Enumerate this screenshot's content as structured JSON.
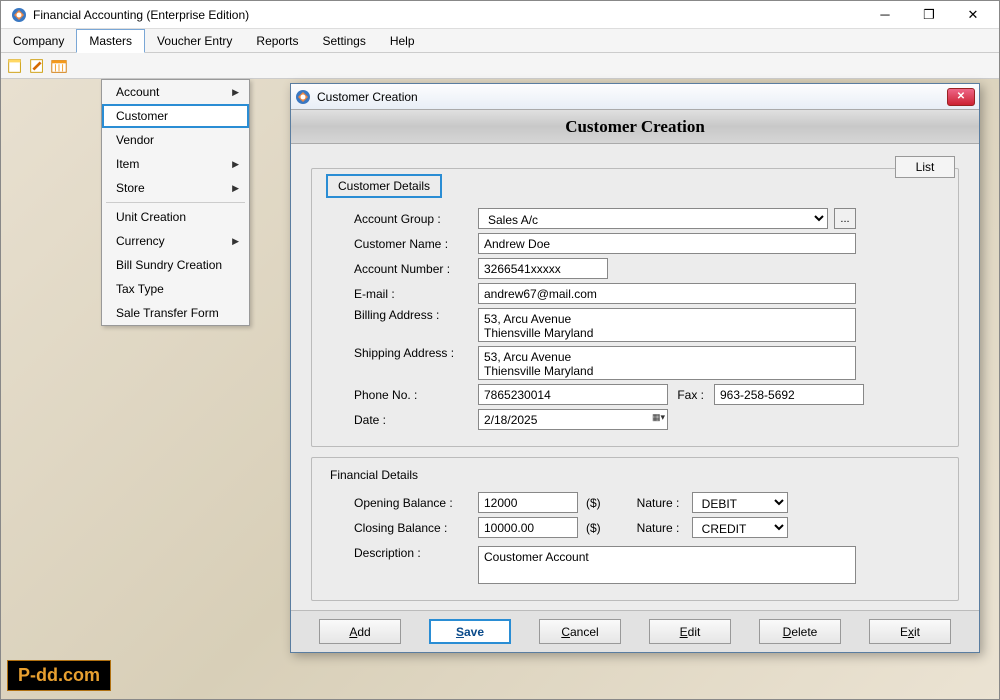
{
  "app": {
    "title": "Financial Accounting (Enterprise Edition)"
  },
  "menu": {
    "items": [
      "Company",
      "Masters",
      "Voucher Entry",
      "Reports",
      "Settings",
      "Help"
    ],
    "active": "Masters"
  },
  "masters_dropdown": {
    "groups": [
      [
        "Account",
        "Customer",
        "Vendor",
        "Item",
        "Store"
      ],
      [
        "Unit Creation",
        "Currency",
        "Bill Sundry Creation",
        "Tax Type",
        "Sale Transfer Form"
      ]
    ],
    "has_submenu": {
      "Account": true,
      "Item": true,
      "Store": true,
      "Currency": true
    },
    "selected": "Customer"
  },
  "dialog": {
    "title": "Customer Creation",
    "heading": "Customer Creation",
    "list_btn": "List",
    "section1": "Customer Details",
    "section2": "Financial Details",
    "labels": {
      "account_group": "Account Group :",
      "customer_name": "Customer Name :",
      "account_number": "Account Number :",
      "email": "E-mail :",
      "billing_address": "Billing Address :",
      "shipping_address": "Shipping Address :",
      "phone": "Phone No. :",
      "fax": "Fax :",
      "date": "Date :",
      "opening_balance": "Opening Balance :",
      "closing_balance": "Closing Balance :",
      "nature": "Nature :",
      "description": "Description :"
    },
    "values": {
      "account_group": "Sales A/c",
      "customer_name": "Andrew Doe",
      "account_number": "3266541xxxxx",
      "email": "andrew67@mail.com",
      "billing_address": "53, Arcu Avenue\nThiensville Maryland",
      "shipping_address": "53, Arcu Avenue\nThiensville Maryland",
      "phone": "7865230014",
      "fax": "963-258-5692",
      "date": "2/18/2025",
      "opening_balance": "12000",
      "closing_balance": "10000.00",
      "currency": "($)",
      "nature1": "DEBIT",
      "nature2": "CREDIT",
      "description": "Coustomer Account"
    },
    "buttons": {
      "add": "Add",
      "save": "Save",
      "cancel": "Cancel",
      "edit": "Edit",
      "delete": "Delete",
      "exit": "Exit"
    }
  },
  "watermark": "P-dd.com"
}
